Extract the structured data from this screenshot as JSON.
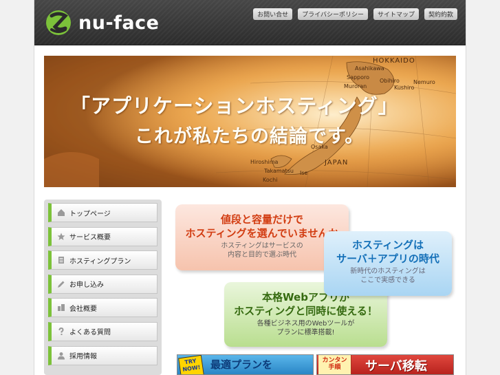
{
  "brand": {
    "name": "nu-face",
    "logo_color": "#7cc23a"
  },
  "top_nav": [
    {
      "label": "お問い合せ"
    },
    {
      "label": "プライバシーポリシー"
    },
    {
      "label": "サイトマップ"
    },
    {
      "label": "契約約款"
    }
  ],
  "hero": {
    "line1": "「アプリケーションホスティング」",
    "line2": "これが私たちの結論です。",
    "map_labels": [
      "HOKKAIDO",
      "Asahikawa",
      "Sapporo",
      "Muroran",
      "Nemuro",
      "Kushiro",
      "Obihiro",
      "JAPAN",
      "Hiroshima",
      "Takamatsu",
      "Kochi",
      "Osaka",
      "Ise"
    ]
  },
  "sidebar": {
    "items": [
      {
        "label": "トップページ",
        "icon": "home-icon"
      },
      {
        "label": "サービス概要",
        "icon": "star-icon"
      },
      {
        "label": "ホスティングプラン",
        "icon": "document-icon"
      },
      {
        "label": "お申し込み",
        "icon": "pencil-icon"
      },
      {
        "label": "会社概要",
        "icon": "building-icon"
      },
      {
        "label": "よくある質問",
        "icon": "question-icon"
      },
      {
        "label": "採用情報",
        "icon": "person-icon"
      }
    ],
    "accent": "#7cc23a"
  },
  "bubbles": [
    {
      "headline1": "値段と容量だけで",
      "headline2": "ホスティングを選んでいませんか",
      "sub1": "ホスティングはサービスの",
      "sub2": "内容と目的で選ぶ時代",
      "color": "#d23d12"
    },
    {
      "headline1": "ホスティングは",
      "headline2": "サーバ＋アプリの時代",
      "sub1": "新時代のホスティングは",
      "sub2": "ここで実感できる",
      "color": "#1470b8"
    },
    {
      "headline1": "本格Webアプリが",
      "headline2": "ホスティングと同時に使える！",
      "sub1": "各種ビジネス用のWebツールが",
      "sub2": "プランに標準搭載!",
      "color": "#356a10"
    }
  ],
  "banners": {
    "left": {
      "badge": "TRY NOW!",
      "text": "最適プランを"
    },
    "right": {
      "badge": "カンタン 手順",
      "text": "サーバ移転"
    }
  }
}
